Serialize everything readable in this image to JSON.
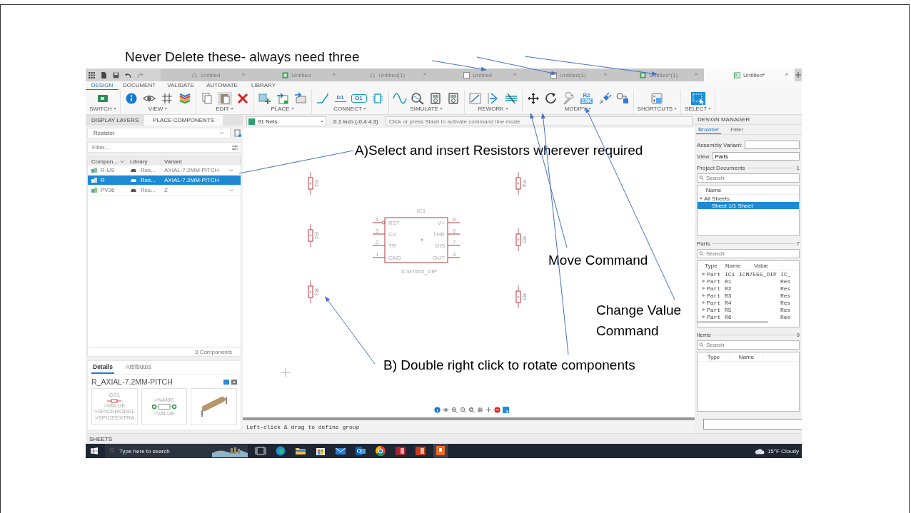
{
  "slide": {
    "heading": "Never Delete these- always need three"
  },
  "annotations": [
    {
      "kind": "text",
      "text": "A)Select and insert Resistors wherever required"
    },
    {
      "kind": "text",
      "text": "Move Command"
    },
    {
      "kind": "text",
      "text": "Change Value Command"
    },
    {
      "kind": "text",
      "text": "B) Double right click to rotate components"
    }
  ],
  "document_tabs": [
    {
      "label": "Untitled",
      "selected": false
    },
    {
      "label": "Untitled",
      "selected": false
    },
    {
      "label": "Untitled(1)",
      "selected": false
    },
    {
      "label": "Untitled",
      "selected": false
    },
    {
      "label": "Untitled(1)",
      "selected": false
    },
    {
      "label": "Untitled*(1)",
      "selected": false
    },
    {
      "label": "Untitled*",
      "selected": true
    }
  ],
  "ribbon_tabs": [
    {
      "label": "DESIGN",
      "selected": true
    },
    {
      "label": "DOCUMENT",
      "selected": false
    },
    {
      "label": "VALIDATE",
      "selected": false
    },
    {
      "label": "AUTOMATE",
      "selected": false
    },
    {
      "label": "LIBRARY",
      "selected": false
    }
  ],
  "toolbar": [
    {
      "label": "SWITCH",
      "tools": [
        {
          "kind": "board"
        }
      ]
    },
    {
      "label": "VIEW",
      "tools": [
        {
          "kind": "info"
        },
        {
          "kind": "eye"
        },
        {
          "kind": "grid"
        },
        {
          "kind": "layers"
        }
      ]
    },
    {
      "label": "EDIT",
      "tools": [
        {
          "kind": "copy"
        },
        {
          "kind": "paste"
        },
        {
          "kind": "cross"
        }
      ]
    },
    {
      "label": "PLACE",
      "tools": [
        {
          "kind": "add-part"
        },
        {
          "kind": "import"
        },
        {
          "kind": "import-box"
        }
      ]
    },
    {
      "label": "CONNECT",
      "tools": [
        {
          "kind": "wire"
        },
        {
          "kind": "text",
          "text": "D1"
        },
        {
          "kind": "tag",
          "text": "D1"
        },
        {
          "kind": "chip"
        }
      ]
    },
    {
      "label": "SIMULATE",
      "tools": [
        {
          "kind": "sine"
        },
        {
          "kind": "probe"
        },
        {
          "kind": "meter"
        },
        {
          "kind": "meter"
        }
      ]
    },
    {
      "label": "REWORK",
      "tools": [
        {
          "kind": "bend"
        },
        {
          "kind": "split"
        },
        {
          "kind": "strike"
        }
      ]
    },
    {
      "label": "MODIFY",
      "tools": [
        {
          "kind": "move"
        },
        {
          "kind": "rotate"
        },
        {
          "kind": "wrench"
        },
        {
          "kind": "value",
          "text": "R2",
          "subtext": "10K"
        },
        {
          "kind": "plug"
        },
        {
          "kind": "swap"
        }
      ]
    },
    {
      "label": "SHORTCUTS",
      "tools": [
        {
          "kind": "window"
        }
      ]
    },
    {
      "label": "SELECT",
      "tools": [
        {
          "kind": "pointer"
        }
      ]
    }
  ],
  "left_panel": {
    "tabs": [
      {
        "label": "DISPLAY LAYERS",
        "selected": false
      },
      {
        "label": "PLACE COMPONENTS",
        "selected": true
      }
    ],
    "library_select": {
      "value": "Resistor"
    },
    "filter": {
      "placeholder": "Filter..."
    },
    "columns": [
      "Compon...",
      "Library",
      "Variant"
    ],
    "rows": [
      {
        "name": "R-US",
        "library": "Res...",
        "variant": "AXIAL-7.2MM-PITCH",
        "selected": false
      },
      {
        "name": "R",
        "library": "Res...",
        "variant": "AXIAL-7.2MM-PITCH",
        "selected": true
      },
      {
        "name": "PV36",
        "library": "Res...",
        "variant": "Z",
        "selected": false
      }
    ],
    "count": "3 Components",
    "details": {
      "tabs": [
        {
          "label": "Details",
          "selected": true
        },
        {
          "label": "Attributes",
          "selected": false
        }
      ],
      "title": "R_AXIAL-7.2MM-PITCH",
      "symbol_texts": [
        "GS1",
        ">VALUE",
        ">SPICEMODEL",
        ">SPICEEXTRA"
      ],
      "footprint_texts": [
        ">NAME",
        ">VALUE"
      ]
    }
  },
  "canvas": {
    "net_select": {
      "value": "91 Nets"
    },
    "coordinates": "0.1 inch (-0.4 4.3)",
    "command_line": {
      "placeholder": "Click or press Slash to activate command line mode"
    },
    "resistors": [
      {
        "name": "R1"
      },
      {
        "name": "R2"
      },
      {
        "name": "R3"
      },
      {
        "name": "R4"
      },
      {
        "name": "R5"
      },
      {
        "name": "R6"
      }
    ],
    "ic": {
      "name": "IC1",
      "value": "ICM7555_DIP",
      "pins": [
        {
          "number": "4",
          "label": "RST",
          "inverted": true
        },
        {
          "number": "5",
          "label": "CV",
          "inverted": false
        },
        {
          "number": "2",
          "label": "TR",
          "inverted": false
        },
        {
          "number": "1",
          "label": "GND",
          "inverted": false
        },
        {
          "number": "8",
          "label": "V+",
          "inverted": false
        },
        {
          "number": "6",
          "label": "THR",
          "inverted": false
        },
        {
          "number": "7",
          "label": "DIS",
          "inverted": false
        },
        {
          "number": "3",
          "label": "OUT",
          "inverted": false
        }
      ]
    },
    "status": "Left-click & drag to define group"
  },
  "design_manager": {
    "title": "DESIGN MANAGER",
    "tabs": [
      {
        "label": "Browser",
        "selected": true
      },
      {
        "label": "Filter",
        "selected": false
      }
    ],
    "assembly_variant": {
      "label": "Assembly Variant:"
    },
    "view": {
      "label": "View:",
      "value": "Parts"
    },
    "project_documents": {
      "title": "Project Documents",
      "count": "1",
      "search_placeholder": "Search",
      "columns": [
        "Name"
      ],
      "tree": [
        {
          "label": "All Sheets",
          "expanded": true,
          "selected": false,
          "children": [
            {
              "label": "Sheet 1/1  Sheet",
              "selected": true
            }
          ]
        }
      ]
    },
    "parts": {
      "title": "Parts",
      "count": "7",
      "search_placeholder": "Search",
      "columns": [
        "Type",
        "Name",
        "Value"
      ],
      "rows": [
        {
          "type": "Part",
          "name": "IC1",
          "value": "ICM7555_DIP",
          "column_4": "IC_"
        },
        {
          "type": "Part",
          "name": "R1",
          "column_4": "Res"
        },
        {
          "type": "Part",
          "name": "R2",
          "column_4": "Res"
        },
        {
          "type": "Part",
          "name": "R3",
          "column_4": "Res"
        },
        {
          "type": "Part",
          "name": "R4",
          "column_4": "Res"
        },
        {
          "type": "Part",
          "name": "R5",
          "column_4": "Res"
        },
        {
          "type": "Part",
          "name": "R6",
          "column_4": "Res"
        }
      ]
    },
    "items": {
      "title": "Items",
      "count": "0",
      "search_placeholder": "Search",
      "columns": [
        "Type",
        "Name"
      ]
    }
  },
  "sheets_bar": {
    "label": "SHEETS"
  },
  "taskbar": {
    "search_placeholder": "Type here to search",
    "apps": [
      {
        "kind": "task-view",
        "active": false
      },
      {
        "kind": "browser",
        "active": false
      },
      {
        "kind": "folder",
        "active": false
      },
      {
        "kind": "store",
        "active": false
      },
      {
        "kind": "mail",
        "active": false
      },
      {
        "kind": "mail-tile",
        "active": false
      },
      {
        "kind": "chrome",
        "active": false
      },
      {
        "kind": "tile",
        "active": false
      },
      {
        "kind": "slides-tile",
        "active": false
      },
      {
        "kind": "app-tile",
        "active": true
      }
    ],
    "weather": "15°F Cloudy"
  }
}
